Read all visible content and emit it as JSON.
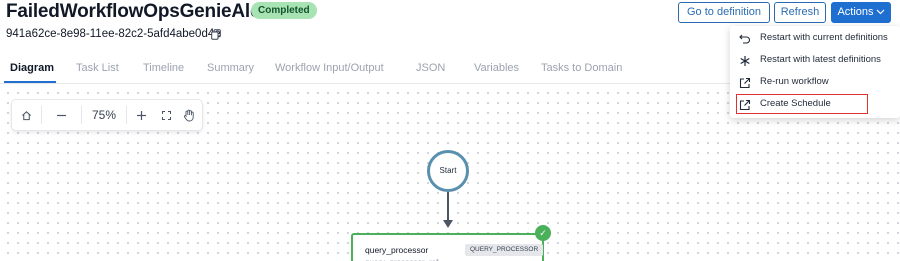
{
  "header": {
    "title": "FailedWorkflowOpsGenieAlerter",
    "status_badge": "Completed",
    "workflow_id": "941a62ce-8e98-11ee-82c2-5afd4abe0d4e",
    "buttons": {
      "go_to_definition": "Go to definition",
      "refresh": "Refresh",
      "actions": "Actions"
    }
  },
  "tabs": [
    {
      "label": "Diagram",
      "active": true
    },
    {
      "label": "Task List",
      "active": false
    },
    {
      "label": "Timeline",
      "active": false
    },
    {
      "label": "Summary",
      "active": false
    },
    {
      "label": "Workflow Input/Output",
      "active": false
    },
    {
      "label": "JSON",
      "active": false
    },
    {
      "label": "Variables",
      "active": false
    },
    {
      "label": "Tasks to Domain",
      "active": false
    }
  ],
  "zoom_toolbar": {
    "zoom_level": "75%",
    "icons": [
      "home-icon",
      "zoom-out-icon",
      "zoom-in-icon",
      "fit-view-icon",
      "pan-hand-icon"
    ]
  },
  "diagram": {
    "start_node_label": "Start",
    "task": {
      "name": "query_processor",
      "ref": "query_processor_ref",
      "type": "QUERY_PROCESSOR",
      "status": "completed"
    }
  },
  "actions_menu": {
    "items": [
      {
        "label": "Restart with current definitions",
        "icon": "restart-icon"
      },
      {
        "label": "Restart with latest definitions",
        "icon": "asterisk-icon"
      },
      {
        "label": "Re-run workflow",
        "icon": "external-link-icon"
      },
      {
        "label": "Create Schedule",
        "icon": "external-link-icon",
        "highlighted": true
      }
    ]
  },
  "colors": {
    "accent": "#1f6fd1",
    "success": "#4bb05a",
    "badge_bg": "#a7e3b3",
    "highlight_border": "#e03131"
  }
}
